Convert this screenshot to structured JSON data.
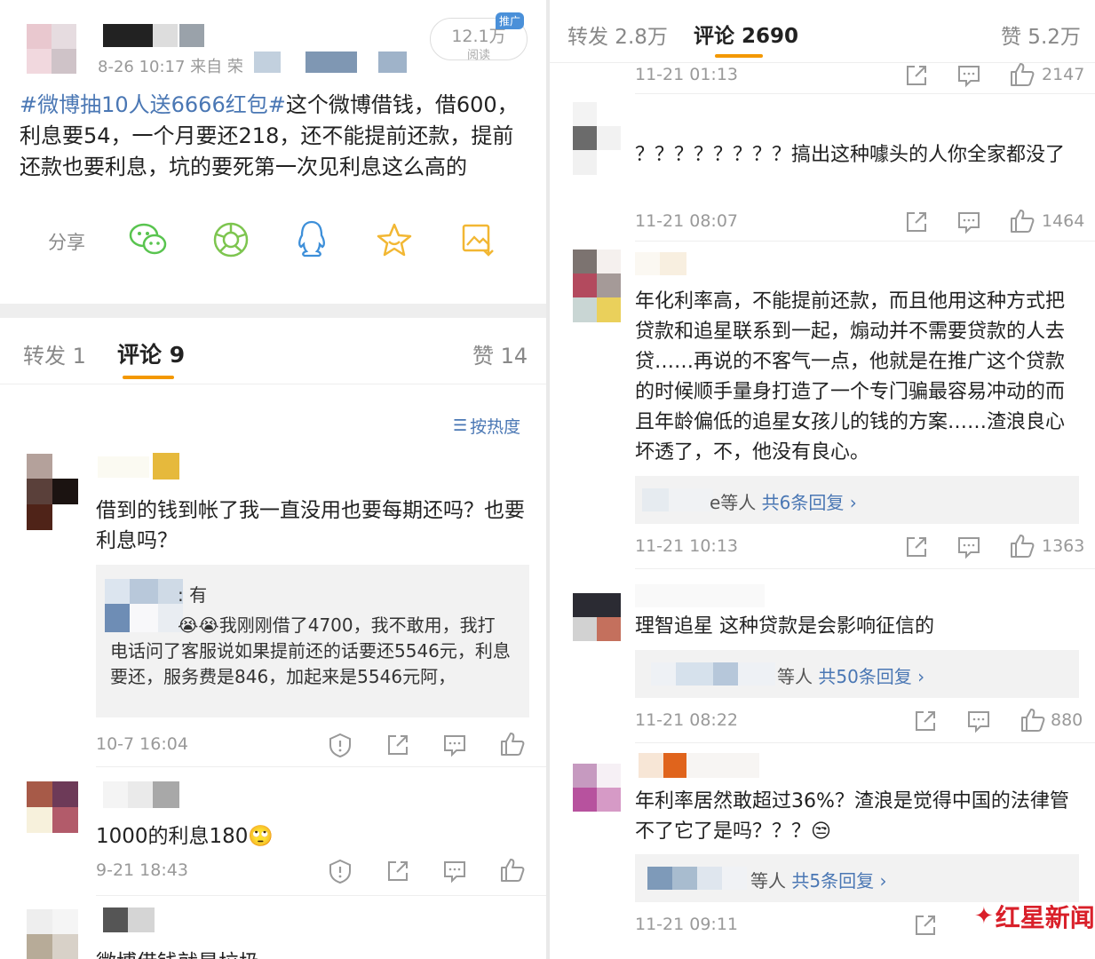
{
  "left": {
    "post": {
      "time_source": "8-26 10:17  来自 荣",
      "reads_value": "12.1万",
      "reads_label": "阅读",
      "promo_badge": "推广",
      "hashtag": "#微博抽10人送6666红包#",
      "text": "这个微博借钱，借600，利息要54，一个月要还218，还不能提前还款，提前还款也要利息，坑的要死第一次见利息这么高的",
      "share_label": "分享"
    },
    "tabs": {
      "forward": "转发 1",
      "comment": "评论 9",
      "like": "赞 14"
    },
    "sort_label": "按热度",
    "comments": [
      {
        "text": "借到的钱到帐了我一直没用也要每期还吗？也要利息吗？",
        "reply_line1": ": 有",
        "reply_line2": "😭😭我刚刚借了4700，我不敢用，我打电话问了客服说如果提前还的话要还5546元，利息要还，服务费是846，加起来是5546元阿，",
        "time": "10-7 16:04"
      },
      {
        "text": "1000的利息180🙄",
        "time": "9-21 18:43"
      },
      {
        "text": "微博借钱就是垃圾"
      }
    ]
  },
  "right": {
    "tabs": {
      "forward": "转发 2.8万",
      "comment": "评论 2690",
      "like": "赞 5.2万"
    },
    "top_row": {
      "time": "11-21 01:13",
      "likes": "2147"
    },
    "comments": [
      {
        "text": "？？？？？？？？搞出这种噱头的人你全家都没了",
        "time": "11-21 08:07",
        "likes": "1464"
      },
      {
        "text": "年化利率高，不能提前还款，而且他用这种方式把贷款和追星联系到一起，煽动并不需要贷款的人去贷……再说的不客气一点，他就是在推广这个贷款的时候顺手量身打造了一个专门骗最容易冲动的而且年龄偏低的追星女孩儿的钱的方案……渣浪良心坏透了，不，他没有良心。",
        "reply_suffix": "e等人",
        "reply_count": "共6条回复 ›",
        "time": "11-21 10:13",
        "likes": "1363"
      },
      {
        "text": "理智追星 这种贷款是会影响征信的",
        "reply_suffix": "等人",
        "reply_count": "共50条回复 ›",
        "time": "11-21 08:22",
        "likes": "880"
      },
      {
        "text": "年利率居然敢超过36%？渣浪是觉得中国的法律管不了它了是吗？？？😒",
        "reply_suffix": "等人",
        "reply_count": "共5条回复 ›",
        "time": "11-21 09:11"
      }
    ],
    "watermark": "红星新闻"
  },
  "colors": {
    "accent": "#f39800",
    "link": "#4a77b4",
    "wechat": "#59c44f",
    "moments": "#7dc54f",
    "qq": "#3d8fd9",
    "star": "#f2b733"
  }
}
